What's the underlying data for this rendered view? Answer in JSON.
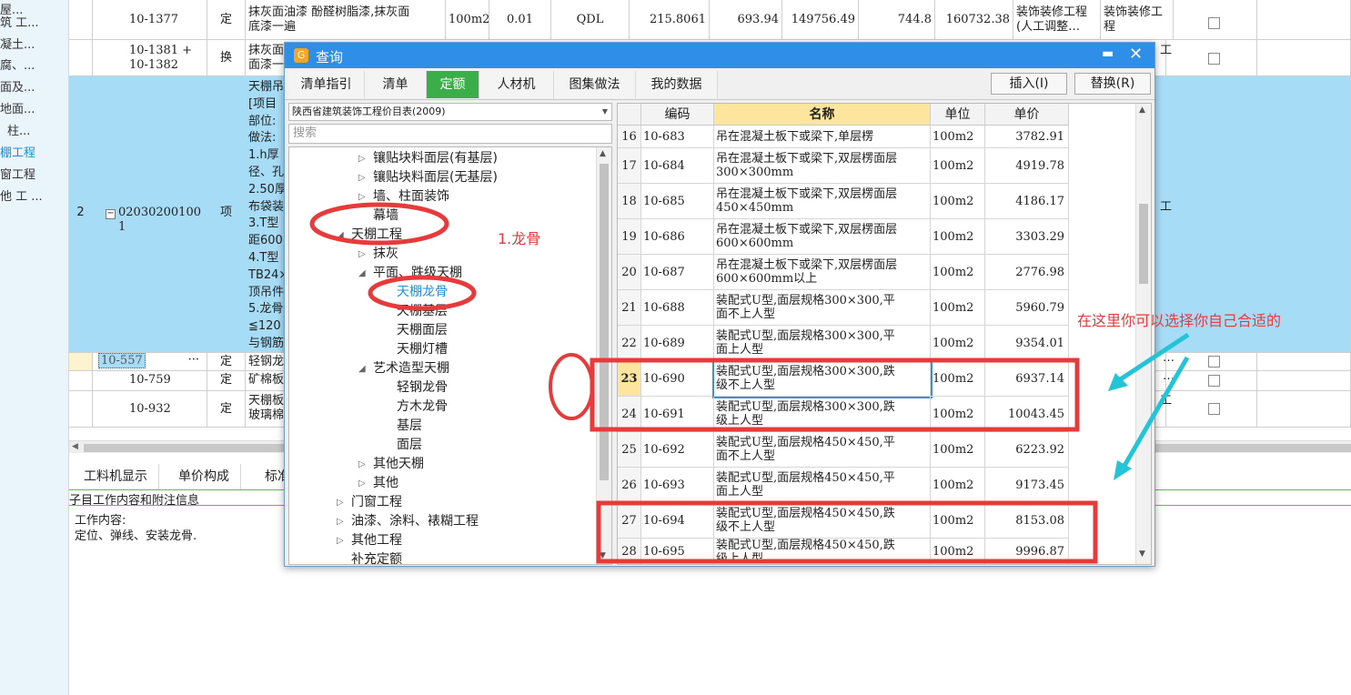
{
  "left_tree": [
    {
      "label": "屋...",
      "sel": false
    },
    {
      "label": "筑 工...",
      "sel": false
    },
    {
      "label": "凝土...",
      "sel": false
    },
    {
      "label": "腐、...",
      "sel": false
    },
    {
      "label": "面及...",
      "sel": false
    },
    {
      "label": "地面...",
      "sel": false
    },
    {
      "label": "柱...",
      "sel": false
    },
    {
      "label": "棚工程",
      "sel": true
    },
    {
      "label": "窗工程",
      "sel": false
    },
    {
      "label": "他 工 ...",
      "sel": false
    }
  ],
  "grid_rows": {
    "r1": {
      "code": "10-1377",
      "type": "定",
      "name1": "抹灰面油漆  酚醛树脂漆,抹灰面",
      "name2": "底漆一遍",
      "unit": "100m2",
      "qty": "0.01",
      "qtyexp": "QDL",
      "v1": "215.8061",
      "v2": "693.94",
      "v3": "149756.49",
      "v4": "744.8",
      "v5": "160732.38",
      "cat1a": "装饰装修工程",
      "cat1b": "(人工调整…",
      "cat2a": "装饰装修工",
      "cat2b": "程"
    },
    "r2": {
      "code": "10-1381 +",
      "code2": "10-1382",
      "type": "换",
      "name1": "抹灰面",
      "name2": "面漆一",
      "cat": "工"
    },
    "r3": {
      "num": "2",
      "code": "02030200100",
      "code2": "1",
      "type": "项",
      "lines": [
        "天棚吊",
        "[项目",
        "部位:",
        "做法:",
        "1.h厚",
        "径、孔",
        "2.50厚",
        "布袋装",
        "3.T型",
        "距600",
        "4.T型",
        "TB24×",
        "顶吊件",
        "5.龙骨",
        "≦120",
        "与钢筋"
      ],
      "cat": "工"
    },
    "r4": {
      "code": "10-557",
      "type": "定",
      "name": "轻钢龙",
      "dots": "···"
    },
    "r5": {
      "code": "10-759",
      "type": "定",
      "name": "矿棉板"
    },
    "r6": {
      "code": "10-932",
      "type": "定",
      "name1": "天棚板",
      "name2": "玻璃棉",
      "cat": "工"
    }
  },
  "bottom_panel": {
    "tabs": [
      "工料机显示",
      "单价构成",
      "标准"
    ],
    "header": "子目工作内容和附注信息",
    "content_label": "工作内容:",
    "content": "定位、弹线、安装龙骨."
  },
  "dialog": {
    "title": "查询",
    "tabs": [
      {
        "label": "清单指引",
        "active": false
      },
      {
        "label": "清单",
        "active": false
      },
      {
        "label": "定额",
        "active": true
      },
      {
        "label": "人材机",
        "active": false
      },
      {
        "label": "图集做法",
        "active": false
      },
      {
        "label": "我的数据",
        "active": false
      }
    ],
    "insert_label": "插入(I)",
    "replace_label": "替换(R)",
    "library": "陕西省建筑装饰工程价目表(2009)",
    "search_placeholder": "搜索",
    "tree": [
      {
        "label": "镶贴块料面层(有基层)",
        "level": 3,
        "arrow": "closed",
        "sel": false
      },
      {
        "label": "镶贴块料面层(无基层)",
        "level": 3,
        "arrow": "closed",
        "sel": false
      },
      {
        "label": "墙、柱面装饰",
        "level": 3,
        "arrow": "closed",
        "sel": false
      },
      {
        "label": "幕墙",
        "level": 3,
        "arrow": "none",
        "sel": false
      },
      {
        "label": "天棚工程",
        "level": 2,
        "arrow": "open",
        "sel": false
      },
      {
        "label": "抹灰",
        "level": 3,
        "arrow": "closed",
        "sel": false
      },
      {
        "label": "平面、跌级天棚",
        "level": 3,
        "arrow": "open",
        "sel": false
      },
      {
        "label": "天棚龙骨",
        "level": 4,
        "arrow": "none",
        "sel": true
      },
      {
        "label": "天棚基层",
        "level": 4,
        "arrow": "none",
        "sel": false
      },
      {
        "label": "天棚面层",
        "level": 4,
        "arrow": "none",
        "sel": false
      },
      {
        "label": "天棚灯槽",
        "level": 4,
        "arrow": "none",
        "sel": false
      },
      {
        "label": "艺术造型天棚",
        "level": 3,
        "arrow": "open",
        "sel": false
      },
      {
        "label": "轻钢龙骨",
        "level": 4,
        "arrow": "none",
        "sel": false
      },
      {
        "label": "方木龙骨",
        "level": 4,
        "arrow": "none",
        "sel": false
      },
      {
        "label": "基层",
        "level": 4,
        "arrow": "none",
        "sel": false
      },
      {
        "label": "面层",
        "level": 4,
        "arrow": "none",
        "sel": false
      },
      {
        "label": "其他天棚",
        "level": 3,
        "arrow": "closed",
        "sel": false
      },
      {
        "label": "其他",
        "level": 3,
        "arrow": "closed",
        "sel": false
      },
      {
        "label": "门窗工程",
        "level": 2,
        "arrow": "closed",
        "sel": false
      },
      {
        "label": "油漆、涂料、裱糊工程",
        "level": 2,
        "arrow": "closed",
        "sel": false
      },
      {
        "label": "其他工程",
        "level": 2,
        "arrow": "closed",
        "sel": false
      },
      {
        "label": "补充定额",
        "level": 2,
        "arrow": "none",
        "sel": false
      }
    ],
    "table_headers": {
      "code": "编码",
      "name": "名称",
      "unit": "单位",
      "price": "单价"
    },
    "table_rows": [
      {
        "n": "16",
        "code": "10-683",
        "name1": "吊在混凝土板下或梁下,单层楞",
        "name2": "",
        "unit": "100m2",
        "price": "3782.91"
      },
      {
        "n": "17",
        "code": "10-684",
        "name1": "吊在混凝土板下或梁下,双层楞面层",
        "name2": "300×300mm",
        "unit": "100m2",
        "price": "4919.78"
      },
      {
        "n": "18",
        "code": "10-685",
        "name1": "吊在混凝土板下或梁下,双层楞面层",
        "name2": "450×450mm",
        "unit": "100m2",
        "price": "4186.17"
      },
      {
        "n": "19",
        "code": "10-686",
        "name1": "吊在混凝土板下或梁下,双层楞面层",
        "name2": "600×600mm",
        "unit": "100m2",
        "price": "3303.29"
      },
      {
        "n": "20",
        "code": "10-687",
        "name1": "吊在混凝土板下或梁下,双层楞面层",
        "name2": "600×600mm以上",
        "unit": "100m2",
        "price": "2776.98"
      },
      {
        "n": "21",
        "code": "10-688",
        "name1": "装配式U型,面层规格300×300,平",
        "name2": "面不上人型",
        "unit": "100m2",
        "price": "5960.79"
      },
      {
        "n": "22",
        "code": "10-689",
        "name1": "装配式U型,面层规格300×300,平",
        "name2": "面上人型",
        "unit": "100m2",
        "price": "9354.01"
      },
      {
        "n": "23",
        "code": "10-690",
        "name1": "装配式U型,面层规格300×300,跌",
        "name2": "级不上人型",
        "unit": "100m2",
        "price": "6937.14",
        "current": true
      },
      {
        "n": "24",
        "code": "10-691",
        "name1": "装配式U型,面层规格300×300,跌",
        "name2": "级上人型",
        "unit": "100m2",
        "price": "10043.45"
      },
      {
        "n": "25",
        "code": "10-692",
        "name1": "装配式U型,面层规格450×450,平",
        "name2": "面不上人型",
        "unit": "100m2",
        "price": "6223.92"
      },
      {
        "n": "26",
        "code": "10-693",
        "name1": "装配式U型,面层规格450×450,平",
        "name2": "面上人型",
        "unit": "100m2",
        "price": "9173.45"
      },
      {
        "n": "27",
        "code": "10-694",
        "name1": "装配式U型,面层规格450×450,跌",
        "name2": "级不上人型",
        "unit": "100m2",
        "price": "8153.08"
      },
      {
        "n": "28",
        "code": "10-695",
        "name1": "装配式U型,面层规格450×450,跌",
        "name2": "级上人型",
        "unit": "100m2",
        "price": "9996.87"
      }
    ]
  },
  "annotations": {
    "label_keel": "1.龙骨",
    "hint": "在这里你可以选择你自己合适的",
    "color_red": "#e83a3a",
    "color_cyan": "#23c4d6"
  }
}
